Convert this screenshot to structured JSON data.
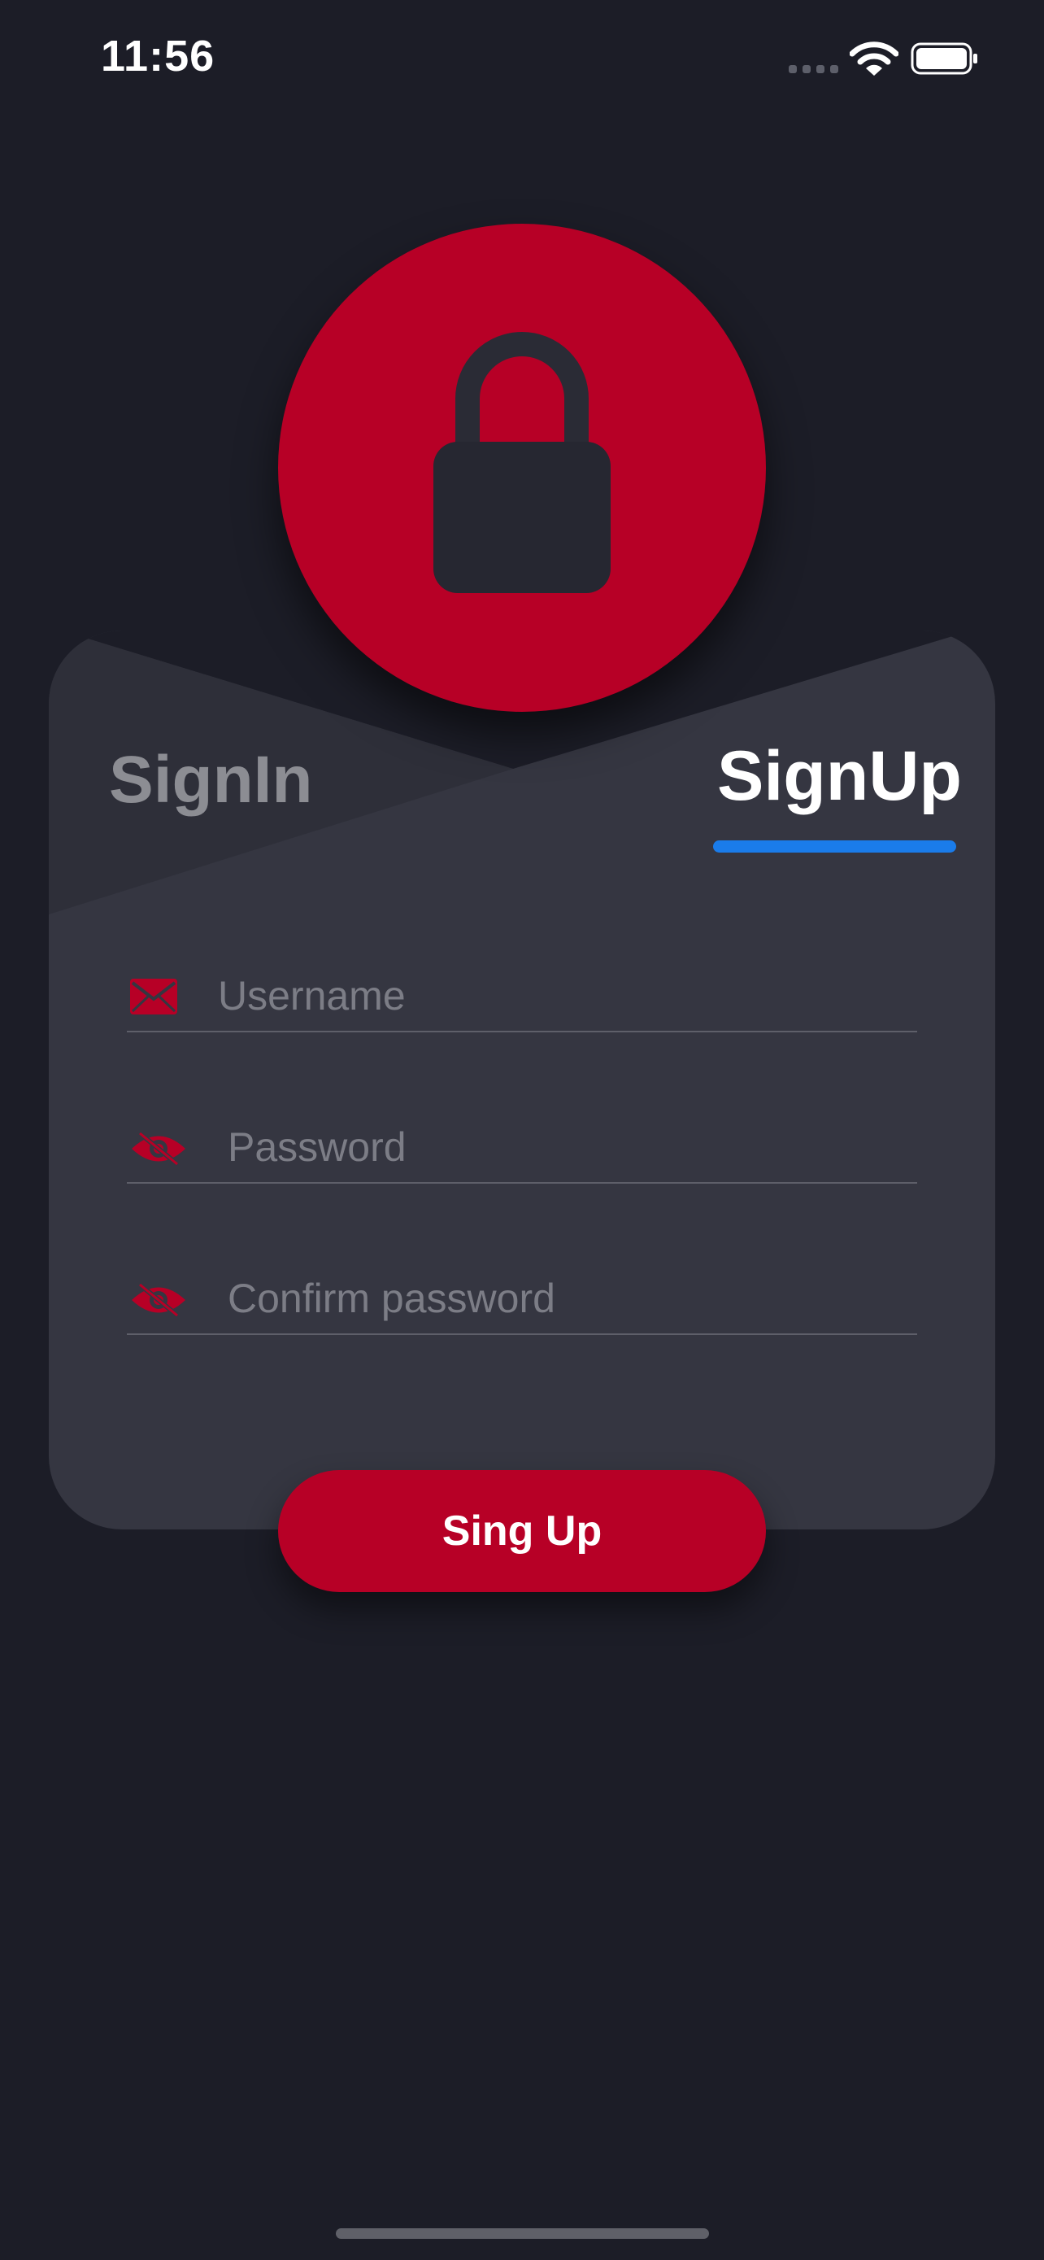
{
  "status_bar": {
    "time": "11:56"
  },
  "tabs": [
    {
      "label": "SignIn",
      "active": false
    },
    {
      "label": "SignUp",
      "active": true
    }
  ],
  "form": {
    "username": {
      "placeholder": "Username",
      "icon": "envelope-icon"
    },
    "password": {
      "placeholder": "Password",
      "icon": "eye-slash-icon"
    },
    "confirm_password": {
      "placeholder": "Confirm password",
      "icon": "eye-slash-icon"
    }
  },
  "submit_label": "Sing Up",
  "colors": {
    "background": "#1c1d27",
    "card": "#353641",
    "accent": "#b70026",
    "tab_indicator": "#1a7cea",
    "text_primary": "#ffffff",
    "text_muted": "#8c8d93"
  }
}
